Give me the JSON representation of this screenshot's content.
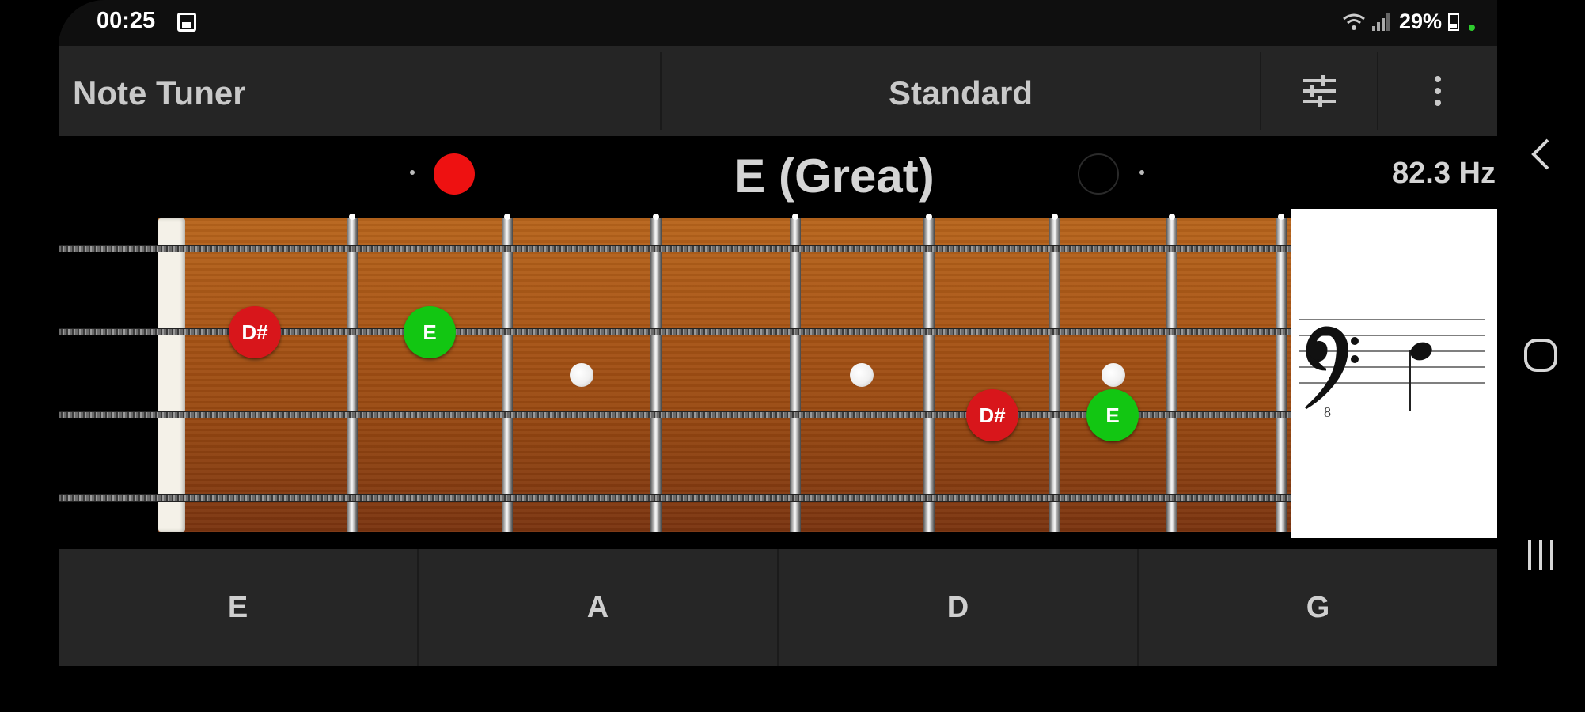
{
  "status_bar": {
    "time": "00:25",
    "battery": "29%",
    "icons": [
      "gallery-notification-icon",
      "wifi-icon",
      "signal-icon",
      "battery-icon"
    ]
  },
  "toolbar": {
    "title": "Note Tuner",
    "tuning": "Standard",
    "settings_icon": "sliders-icon",
    "menu_icon": "more-vert-icon"
  },
  "readout": {
    "note": "E (Great)",
    "frequency": "82.3 Hz",
    "flat_indicator_color": "#ee1111",
    "sharp_indicator_color": "#000000"
  },
  "fretboard": {
    "strings_count": 4,
    "inlay_frets": [
      3,
      5,
      7
    ],
    "markers": [
      {
        "label": "D#",
        "string": 3,
        "fret": 1,
        "color": "#d8161b"
      },
      {
        "label": "E",
        "string": 3,
        "fret": 2,
        "color": "#12c612"
      },
      {
        "label": "D#",
        "string": 2,
        "fret": 6,
        "color": "#d8161b"
      },
      {
        "label": "E",
        "string": 2,
        "fret": 7,
        "color": "#12c612"
      }
    ]
  },
  "staff": {
    "clef": "bass-clef-8vb",
    "octave_mark": "8"
  },
  "strings": {
    "buttons": [
      "E",
      "A",
      "D",
      "G"
    ]
  },
  "nav": {
    "back_icon": "back-chevron-icon",
    "home_icon": "home-icon",
    "recents_icon": "recents-icon"
  }
}
